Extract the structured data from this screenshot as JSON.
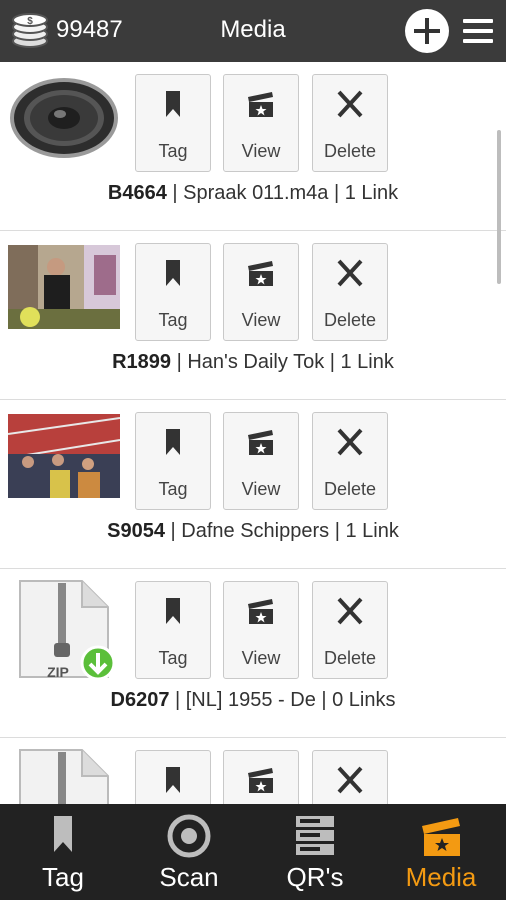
{
  "header": {
    "coins_icon": "coins-stack-icon",
    "coin_count": "99487",
    "title": "Media",
    "add_icon": "plus-circle-icon",
    "menu_icon": "hamburger-menu-icon"
  },
  "actions": {
    "tag_label": "Tag",
    "view_label": "View",
    "delete_label": "Delete"
  },
  "items": [
    {
      "code": "B4664",
      "details": " | Spraak 011.m4a | 1 Link",
      "thumbnail": "speaker"
    },
    {
      "code": "R1899",
      "details": " | Han's Daily Tok | 1 Link",
      "thumbnail": "video-still"
    },
    {
      "code": "S9054",
      "details": " | Dafne Schippers | 1 Link",
      "thumbnail": "video-still"
    },
    {
      "code": "D6207",
      "details": " | [NL] 1955 - De | 0 Links",
      "thumbnail": "zip-download"
    },
    {
      "code": "",
      "details": "",
      "thumbnail": "zip"
    }
  ],
  "bottom_nav": [
    {
      "label": "Tag",
      "icon": "bookmark-icon",
      "active": false
    },
    {
      "label": "Scan",
      "icon": "scan-target-icon",
      "active": false
    },
    {
      "label": "QR's",
      "icon": "server-stack-icon",
      "active": false
    },
    {
      "label": "Media",
      "icon": "media-clapper-icon",
      "active": true
    }
  ],
  "colors": {
    "topbar": "#3b3b3b",
    "bottom_nav": "#222222",
    "active_accent": "#f39a12"
  }
}
